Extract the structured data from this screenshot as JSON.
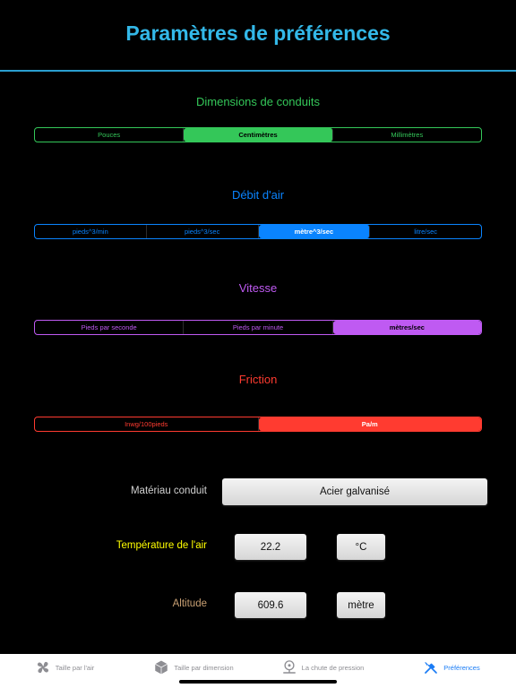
{
  "title": "Paramètres de préférences",
  "colors": {
    "title": "#33b8e8",
    "green": "#34c759",
    "blue": "#0a84ff",
    "purple": "#bf5af2",
    "red": "#ff3b30",
    "yellow": "#ffff00",
    "tan": "#c8a073"
  },
  "sections": [
    {
      "label": "Dimensions de conduits",
      "options": [
        "Pouces",
        "Centimètres",
        "Millimètres"
      ],
      "selected": 1
    },
    {
      "label": "Débit d'air",
      "options": [
        "pieds^3/min",
        "pieds^3/sec",
        "mètre^3/sec",
        "litre/sec"
      ],
      "selected": 2
    },
    {
      "label": "Vitesse",
      "options": [
        "Pieds par seconde",
        "Pieds par minute",
        "mètres/sec"
      ],
      "selected": 2
    },
    {
      "label": "Friction",
      "options": [
        "Inwg/100pieds",
        "Pa/m"
      ],
      "selected": 1
    }
  ],
  "material": {
    "label": "Matériau conduit",
    "value": "Acier galvanisé"
  },
  "temperature": {
    "label": "Température de l'air",
    "value": "22.2",
    "unit": "°C"
  },
  "altitude": {
    "label": "Altitude",
    "value": "609.6",
    "unit": "mètre"
  },
  "tabs": [
    {
      "label": "Taille par l'air",
      "icon": "fan-icon",
      "active": false
    },
    {
      "label": "Taille par dimension",
      "icon": "box-icon",
      "active": false
    },
    {
      "label": "La chute de pression",
      "icon": "gauge-pin-icon",
      "active": false
    },
    {
      "label": "Préférences",
      "icon": "tools-icon",
      "active": true
    }
  ]
}
